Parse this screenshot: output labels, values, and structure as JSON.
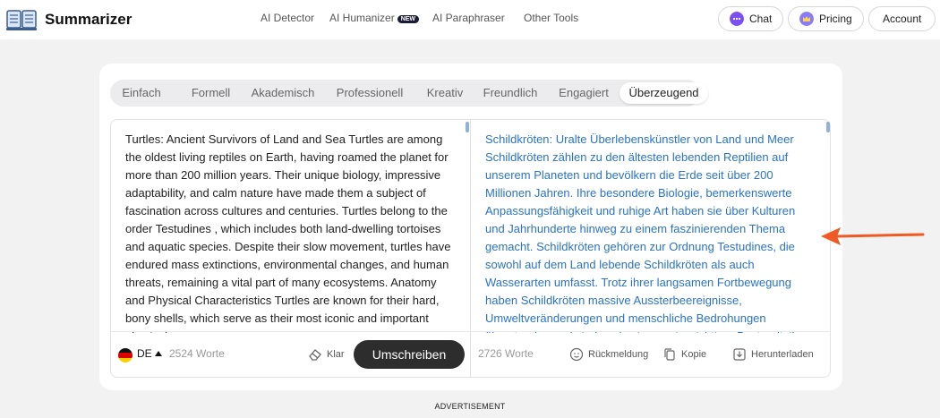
{
  "header": {
    "app_title": "Summarizer",
    "nav": [
      {
        "label": "AI Detector"
      },
      {
        "label": "AI Humanizer",
        "badge": "NEW"
      },
      {
        "label": "AI Paraphraser"
      },
      {
        "label": "Other Tools"
      }
    ],
    "chat_label": "Chat",
    "pricing_label": "Pricing",
    "account_label": "Account"
  },
  "tabs": [
    {
      "label": "Einfach"
    },
    {
      "label": "Formell"
    },
    {
      "label": "Akademisch"
    },
    {
      "label": "Professionell"
    },
    {
      "label": "Kreativ"
    },
    {
      "label": "Freundlich"
    },
    {
      "label": "Engagiert"
    },
    {
      "label": "Überzeugend",
      "active": true
    }
  ],
  "input": {
    "text": "Turtles: Ancient Survivors of Land and Sea Turtles are among the oldest living reptiles on Earth, having roamed the planet for more than 200 million years. Their unique biology, impressive adaptability, and calm nature have made them a subject of fascination across cultures and centuries. Turtles belong to the order Testudines , which includes both land-dwelling tortoises and aquatic species. Despite their slow movement, turtles have endured mass extinctions, environmental changes, and human threats, remaining a vital part of many ecosystems. Anatomy and Physical Characteristics Turtles are known for their hard, bony shells, which serve as their most iconic and important physical",
    "language": "DE",
    "word_count": "2524 Worte",
    "clear_label": "Klar",
    "rewrite_label": "Umschreiben"
  },
  "output": {
    "text": "Schildkröten: Uralte Überlebenskünstler von Land und Meer Schildkröten zählen zu den ältesten lebenden Reptilien auf unserem Planeten und bevölkern die Erde seit über 200 Millionen Jahren. Ihre besondere Biologie, bemerkenswerte Anpassungsfähigkeit und ruhige Art haben sie über Kulturen und Jahrhunderte hinweg zu einem faszinierenden Thema gemacht. Schildkröten gehören zur Ordnung Testudines, die sowohl auf dem Land lebende Schildkröten als auch Wasserarten umfasst. Trotz ihrer langsamen Fortbewegung haben Schildkröten massive Aussterbeereignisse, Umweltveränderungen und menschliche Bedrohungen überstanden und sind nach wie vor ein wichtiger Bestandteil",
    "word_count": "2726 Worte",
    "feedback_label": "Rückmeldung",
    "copy_label": "Kopie",
    "download_label": "Herunterladen"
  },
  "advertisement_label": "ADVERTISEMENT",
  "colors": {
    "output_text": "#2a73c8",
    "annotation_arrow": "#f05a24",
    "button_dark": "#2d2d2d"
  }
}
